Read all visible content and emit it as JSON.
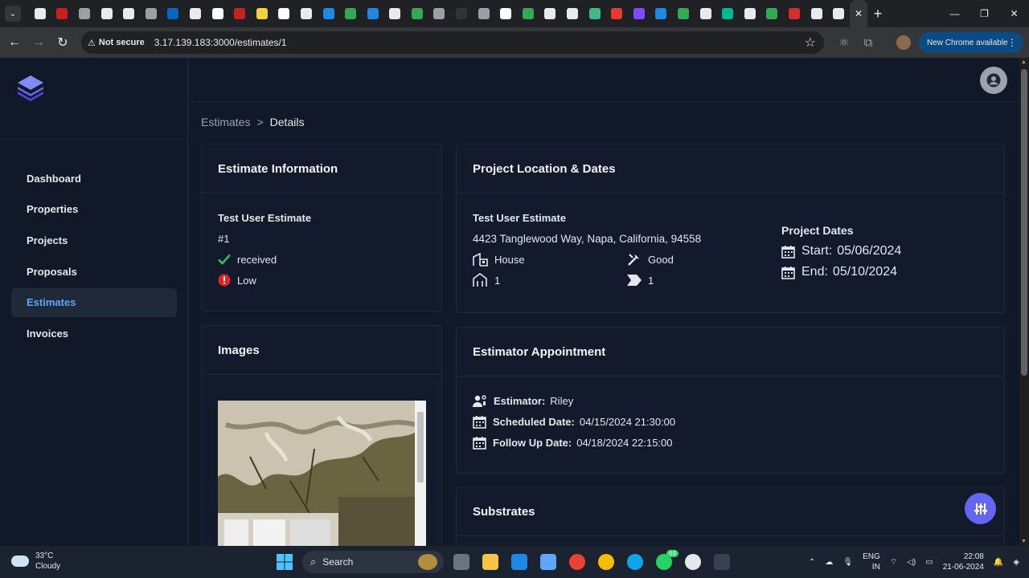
{
  "browser": {
    "tab_close": "✕",
    "new_tab": "+",
    "not_secure": "Not secure",
    "url": "3.17.139.183:3000/estimates/1",
    "update_label": "New Chrome available",
    "favicon_colors": [
      "#e8eaed",
      "#c5221f",
      "#9aa0a6",
      "#e8eaed",
      "#e8eaed",
      "#9aa0a6",
      "#0a66c2",
      "#e8eaed",
      "#ffffff",
      "#c5221f",
      "#f4d03f",
      "#ffffff",
      "#e8eaed",
      "#1e88e5",
      "#34a853",
      "#1e88e5",
      "#e8eaed",
      "#34a853",
      "#9aa0a6",
      "#333",
      "#9aa0a6",
      "#ffffff",
      "#34a853",
      "#e8eaed",
      "#e8eaed",
      "#42b883",
      "#e53935",
      "#7c4dff",
      "#1e88e5",
      "#34a853",
      "#e8eaed",
      "#00b894",
      "#e8eaed",
      "#34a853",
      "#d32f2f",
      "#e8eaed",
      "#e8eaed"
    ]
  },
  "breadcrumb": {
    "parent": "Estimates",
    "separator": ">",
    "current": "Details"
  },
  "sidebar": {
    "items": [
      {
        "label": "Dashboard"
      },
      {
        "label": "Properties"
      },
      {
        "label": "Projects"
      },
      {
        "label": "Proposals"
      },
      {
        "label": "Estimates"
      },
      {
        "label": "Invoices"
      }
    ],
    "active": "Estimates"
  },
  "estimate_info": {
    "title": "Estimate Information",
    "name": "Test User Estimate",
    "number": "#1",
    "status": "received",
    "priority": "Low"
  },
  "location": {
    "title": "Project Location & Dates",
    "name": "Test User Estimate",
    "address": "4423 Tanglewood Way, Napa, California, 94558",
    "property_type": "House",
    "condition": "Good",
    "floors": "1",
    "tag_count": "1",
    "dates_title": "Project Dates",
    "start_label": "Start:",
    "start": "05/06/2024",
    "end_label": "End:",
    "end": "05/10/2024"
  },
  "images": {
    "title": "Images"
  },
  "appointment": {
    "title": "Estimator Appointment",
    "estimator_label": "Estimator:",
    "estimator": "Riley",
    "scheduled_label": "Scheduled Date:",
    "scheduled": "04/15/2024 21:30:00",
    "followup_label": "Follow Up Date:",
    "followup": "04/18/2024 22:15:00"
  },
  "substrates": {
    "title": "Substrates"
  },
  "taskbar": {
    "temp": "33°C",
    "weather": "Cloudy",
    "search": "Search",
    "badge": "69",
    "lang1": "ENG",
    "lang2": "IN",
    "time": "22:08",
    "date": "21-06-2024"
  }
}
